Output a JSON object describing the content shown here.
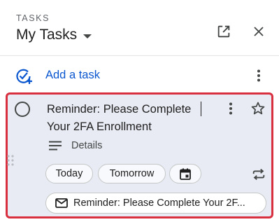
{
  "header": {
    "eyebrow": "TASKS",
    "list_title": "My Tasks"
  },
  "add_task": {
    "label": "Add a task"
  },
  "task": {
    "title": "Reminder: Please Complete Your 2FA Enrollment",
    "details_label": "Details",
    "chips": {
      "today": "Today",
      "tomorrow": "Tomorrow"
    },
    "email_link": "Reminder: Please Complete Your 2F..."
  },
  "icons": {
    "caret": "chevron-down-icon",
    "open_in_new": "open-in-new-icon",
    "close": "close-icon",
    "add_task": "add-task-icon",
    "more": "more-vert-icon",
    "complete": "circle-icon",
    "star": "star-outline-icon",
    "details": "notes-icon",
    "calendar": "calendar-icon",
    "repeat": "repeat-icon",
    "email": "mail-icon",
    "drag": "drag-handle-icon"
  },
  "colors": {
    "accent": "#0b57d0",
    "highlight_border": "#d93040",
    "card_background": "#e8ebf3"
  }
}
